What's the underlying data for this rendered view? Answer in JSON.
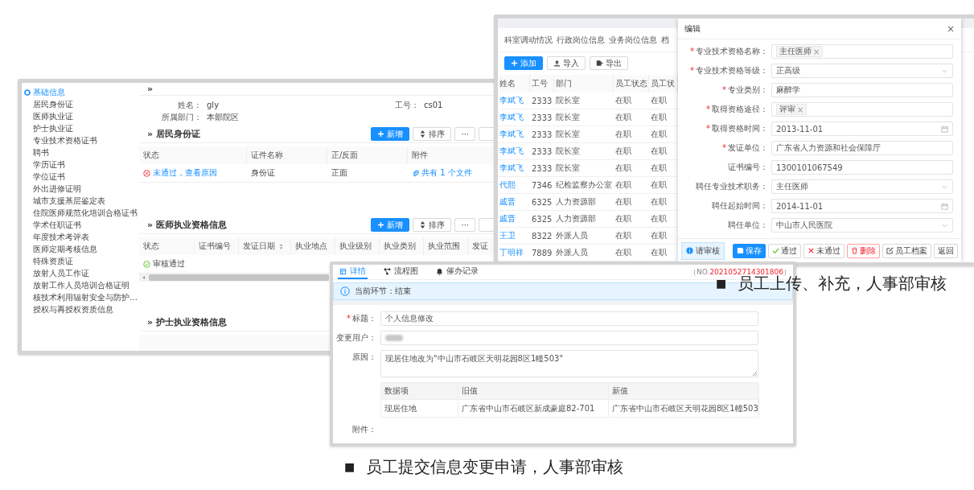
{
  "profile_window": {
    "sidebar": {
      "items": [
        {
          "label": "基础信息",
          "selected": true
        },
        {
          "label": "居民身份证",
          "selected": false
        },
        {
          "label": "医师执业证",
          "selected": false
        },
        {
          "label": "护士执业证",
          "selected": false
        },
        {
          "label": "专业技术资格证书",
          "selected": false
        },
        {
          "label": "聘书",
          "selected": false
        },
        {
          "label": "学历证书",
          "selected": false
        },
        {
          "label": "学位证书",
          "selected": false
        },
        {
          "label": "外出进修证明",
          "selected": false
        },
        {
          "label": "城市支援基层鉴定表",
          "selected": false
        },
        {
          "label": "住院医师规范化培训合格证书",
          "selected": false
        },
        {
          "label": "学术任职证书",
          "selected": false
        },
        {
          "label": "年度技术考评表",
          "selected": false
        },
        {
          "label": "医师定期考核信息",
          "selected": false
        },
        {
          "label": "特殊资质证",
          "selected": false
        },
        {
          "label": "放射人员工作证",
          "selected": false
        },
        {
          "label": "放射工作人员培训合格证明",
          "selected": false
        },
        {
          "label": "核技术利用辐射安全与防护…",
          "selected": false
        },
        {
          "label": "授权与再授权资质信息",
          "selected": false
        }
      ]
    },
    "expand_toggle": "»",
    "fields": [
      {
        "label": "姓名：",
        "value": "gly"
      },
      {
        "label": "工号：",
        "value": "cs01"
      },
      {
        "label": "所属部门：",
        "value": "本部院区"
      }
    ],
    "sections": [
      {
        "title": "» 居民身份证",
        "buttons": [
          {
            "kind": "add",
            "label": "新增"
          },
          {
            "kind": "sort",
            "label": "排序"
          },
          {
            "kind": "more",
            "label": "···"
          },
          {
            "kind": "blank"
          }
        ],
        "table": {
          "columns": [
            {
              "label": "状态",
              "sortable": false
            },
            {
              "label": "证件名称",
              "sortable": false
            },
            {
              "label": "正/反面",
              "sortable": false
            },
            {
              "label": "附件",
              "sortable": false
            }
          ],
          "rows": [
            [
              {
                "kind": "rejected",
                "text": "未通过，查看原因"
              },
              {
                "kind": "plain",
                "text": "身份证"
              },
              {
                "kind": "plain",
                "text": "正面"
              },
              {
                "kind": "attachment",
                "text": "共有 1 个文件"
              }
            ]
          ]
        }
      },
      {
        "title": "» 医师执业资格信息",
        "buttons": [
          {
            "kind": "add",
            "label": "新增"
          },
          {
            "kind": "sort",
            "label": "排序"
          },
          {
            "kind": "more",
            "label": "···"
          },
          {
            "kind": "blank"
          }
        ],
        "table": {
          "columns": [
            {
              "label": "状态",
              "sortable": false
            },
            {
              "label": "证书编号",
              "sortable": false
            },
            {
              "label": "发证日期",
              "sortable": true
            },
            {
              "label": "执业地点",
              "sortable": false
            },
            {
              "label": "执业级别",
              "sortable": false
            },
            {
              "label": "执业类别",
              "sortable": false
            },
            {
              "label": "执业范围",
              "sortable": false
            },
            {
              "label": "发证",
              "sortable": false
            }
          ],
          "rows": [
            [
              {
                "kind": "approved",
                "text": "审核通过"
              }
            ]
          ],
          "scrollbar": true
        }
      },
      {
        "title": "» 护士执业资格信息"
      }
    ]
  },
  "staff_window": {
    "tabs": [
      {
        "label": "科室调动情况"
      },
      {
        "label": "行政岗位信息"
      },
      {
        "label": "业务岗位信息"
      },
      {
        "label": "档"
      }
    ],
    "toolbar": [
      {
        "kind": "add",
        "label": "添加"
      },
      {
        "kind": "import",
        "label": "导入"
      },
      {
        "kind": "export",
        "label": "导出"
      }
    ],
    "table": {
      "columns": [
        {
          "label": "姓名",
          "kind": "link"
        },
        {
          "label": "工号",
          "kind": "plain"
        },
        {
          "label": "部门",
          "kind": "plain"
        },
        {
          "label": "员工状态",
          "kind": "plain"
        },
        {
          "label": "员工状",
          "kind": "plain"
        }
      ],
      "rows": [
        [
          "李斌飞",
          "2333",
          "院长室",
          "在职",
          "在职"
        ],
        [
          "李斌飞",
          "2333",
          "院长室",
          "在职",
          "在职"
        ],
        [
          "李斌飞",
          "2333",
          "院长室",
          "在职",
          "在职"
        ],
        [
          "李斌飞",
          "2333",
          "院长室",
          "在职",
          "在职"
        ],
        [
          "李斌飞",
          "2333",
          "院长室",
          "在职",
          "在职"
        ],
        [
          "代熙",
          "7346",
          "纪检监察办公室",
          "在职",
          "在职"
        ],
        [
          "戚晋",
          "6325",
          "人力资源部",
          "在职",
          "在职"
        ],
        [
          "戚晋",
          "6325",
          "人力资源部",
          "在职",
          "在职"
        ],
        [
          "王卫",
          "8322",
          "外派人员",
          "在职",
          "在职"
        ],
        [
          "丁明祥",
          "7889",
          "外派人员",
          "在职",
          "在职"
        ]
      ]
    },
    "dialog": {
      "title": "编辑",
      "close": "×",
      "fields": [
        {
          "mark": "*",
          "label": "专业技术资格名称：",
          "kind": "tags",
          "tags": [
            {
              "label": "主任医师",
              "remove": "×"
            }
          ]
        },
        {
          "mark": "*",
          "label": "专业技术资格等级：",
          "kind": "select",
          "value": "正高级"
        },
        {
          "mark": "*",
          "label": "专业类别：",
          "kind": "text",
          "value": "麻醉学"
        },
        {
          "mark": "*",
          "label": "取得资格途径：",
          "kind": "tags",
          "tags": [
            {
              "label": "评审",
              "remove": "×"
            }
          ]
        },
        {
          "mark": "*",
          "label": "取得资格时间：",
          "kind": "date",
          "value": "2013-11-01"
        },
        {
          "mark": "*",
          "label": "发证单位：",
          "kind": "text",
          "value": "广东省人力资源和社会保障厅"
        },
        {
          "label": "证书编号：",
          "kind": "text",
          "value": "1300101067549"
        },
        {
          "label": "聘任专业技术职务：",
          "kind": "select",
          "value": "主任医师"
        },
        {
          "label": "聘任起始时间：",
          "kind": "date",
          "value": "2014-11-01"
        },
        {
          "label": "聘任单位：",
          "kind": "select",
          "value": "中山市人民医院"
        }
      ],
      "status_tag": "请审核",
      "buttons": [
        {
          "kind": "save",
          "label": "保存"
        },
        {
          "kind": "pass",
          "label": "通过"
        },
        {
          "kind": "reject",
          "label": "未通过"
        },
        {
          "kind": "delete",
          "label": "删除"
        },
        {
          "kind": "profile",
          "label": "员工档案"
        },
        {
          "kind": "back",
          "label": "返回"
        }
      ]
    }
  },
  "request_window": {
    "tabs": [
      {
        "kind": "detail",
        "label": "详情",
        "selected": true
      },
      {
        "kind": "flow",
        "label": "流程图",
        "selected": false
      },
      {
        "kind": "reminder",
        "label": "催办记录",
        "selected": false
      }
    ],
    "serial": {
      "prefix": "（NO.",
      "number": "2021052714301806",
      "suffix": "）"
    },
    "alert": "当前环节：结束",
    "fields": [
      {
        "mark": "*",
        "label": "标题：",
        "kind": "text",
        "value": "个人信息修改"
      },
      {
        "label": "变更用户：",
        "kind": "redacted"
      },
      {
        "label": "原因：",
        "kind": "textarea",
        "value": "现居住地改为\"中山市石岐区天明花园8区1幢503\""
      }
    ],
    "changes": {
      "columns": [
        "数据项",
        "旧值",
        "新值"
      ],
      "rows": [
        [
          "现居住地",
          "广东省中山市石岐区新成豪庭82-701",
          "广东省中山市石岐区天明花园8区1幢503"
        ]
      ]
    },
    "attachments_label": "附件："
  },
  "captions": [
    {
      "bullet": "■",
      "text": "员工上传、补充，人事部审核"
    },
    {
      "bullet": "■",
      "text": "员工提交信息变更申请，人事部审核"
    }
  ]
}
